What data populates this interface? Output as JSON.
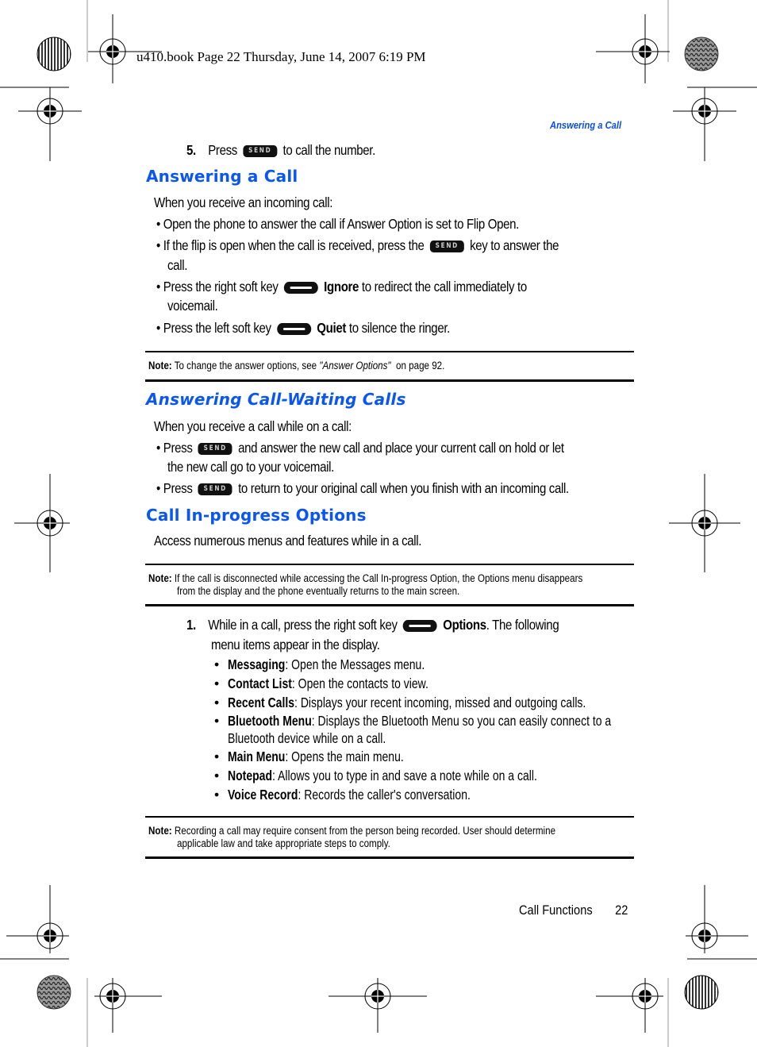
{
  "print_header": "u410.book  Page 22  Thursday, June 14, 2007  6:19 PM",
  "running_head": "Answering a Call",
  "step5": {
    "number": "5.",
    "before": "Press",
    "key": "SEND",
    "after": "to call the number."
  },
  "sections": [
    {
      "title": "Answering a Call",
      "intro": "When you receive an incoming call:",
      "bullets": [
        {
          "lines": [
            "• Open the phone to answer the call if Answer Option is set to Flip Open."
          ]
        },
        {
          "before": "• If the flip is open when the call is received, press the",
          "key": "SEND",
          "after": "key to answer the",
          "line2": "call."
        },
        {
          "before": "• Press the right soft key",
          "key": "soft",
          "bold": "Ignore",
          "after": "to redirect the call immediately to",
          "line2": "voicemail."
        },
        {
          "before": "• Press the left soft key",
          "key": "soft",
          "bold": "Quiet",
          "after": "to silence the ringer."
        }
      ]
    },
    {
      "title": "Answering Call-Waiting Calls",
      "intro": "When you receive a call while on a call:",
      "bullets": [
        {
          "before": "• Press",
          "key": "SEND",
          "after": "and answer the new call and place your current call on hold or let",
          "line2": "the new call go to your voicemail."
        },
        {
          "before": "• Press",
          "key": "SEND",
          "after": "to return to your original call when you finish with an incoming call."
        }
      ]
    },
    {
      "title": "Call In-progress Options",
      "intro": "Access numerous menus and features while in a call."
    }
  ],
  "notes": [
    {
      "label": "Note:",
      "text_before": "To change the answer options, see",
      "italic": "\"Answer Options\"",
      "text_after": "on page 92."
    },
    {
      "label": "Note:",
      "line1": "If the call is disconnected while accessing the Call In-progress Option, the Options menu disappears",
      "line2": "from the display and the phone eventually returns to the main screen."
    },
    {
      "label": "Note:",
      "line1": "Recording a call may require consent from the person being recorded. User should determine",
      "line2": "applicable law and take appropriate steps to comply."
    }
  ],
  "step1": {
    "number": "1.",
    "before": "While in a call, press the right soft key",
    "bold": "Options",
    "after": ". The following",
    "line2": "menu items appear in the display."
  },
  "menu_items": [
    {
      "name": "Messaging",
      "desc": ": Open the Messages menu."
    },
    {
      "name": "Contact List",
      "desc": ": Open the contacts to view."
    },
    {
      "name": "Recent Calls",
      "desc": ": Displays your recent incoming, missed and outgoing calls."
    },
    {
      "name": "Bluetooth Menu",
      "desc": ": Displays the Bluetooth Menu so you can easily connect to a",
      "desc2": "Bluetooth device while on a call."
    },
    {
      "name": "Main Menu",
      "desc": ": Opens the main menu."
    },
    {
      "name": "Notepad",
      "desc": ": Allows you to type in and save a note while on a call."
    },
    {
      "name": "Voice Record",
      "desc": ": Records the caller's conversation."
    }
  ],
  "footer": {
    "section": "Call Functions",
    "page": "22"
  },
  "colors": {
    "heading_blue": "#0a56f0",
    "running_head_blue": "#0a4fe8"
  }
}
